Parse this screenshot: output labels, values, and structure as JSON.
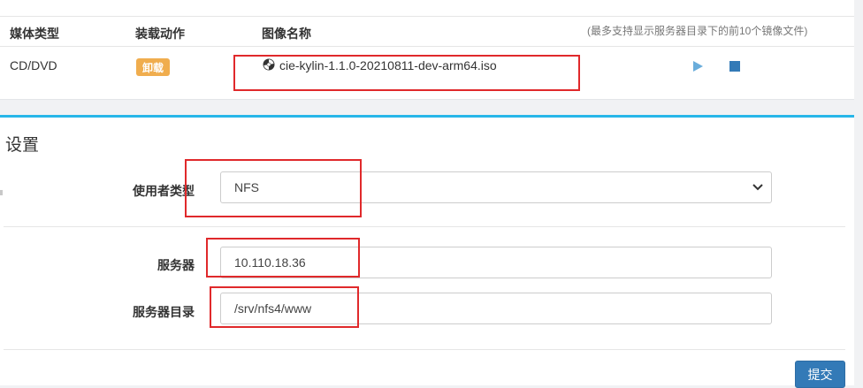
{
  "media_table": {
    "headers": {
      "media_type": "媒体类型",
      "mount_action": "装载动作",
      "image_name": "图像名称"
    },
    "note": "(最多支持显示服务器目录下的前10个镜像文件)",
    "rows": [
      {
        "media_type": "CD/DVD",
        "action_badge": "卸载",
        "image_name": "cie-kylin-1.1.0-20210811-dev-arm64.iso",
        "icons": [
          "disc-icon",
          "play-icon",
          "stop-icon"
        ]
      }
    ]
  },
  "settings": {
    "title": "设置",
    "user_type": {
      "label": "使用者类型",
      "value": "NFS"
    },
    "server": {
      "label": "服务器",
      "value": "10.110.18.36"
    },
    "server_dir": {
      "label": "服务器目录",
      "value": "/srv/nfs4/www"
    },
    "submit_label": "提交"
  },
  "colors": {
    "accent_top_border": "#27b6e8",
    "badge_warning": "#f0ad4e",
    "primary_button": "#337ab7",
    "play_icon": "#6aaddb",
    "annotation_red": "#e0292b"
  }
}
